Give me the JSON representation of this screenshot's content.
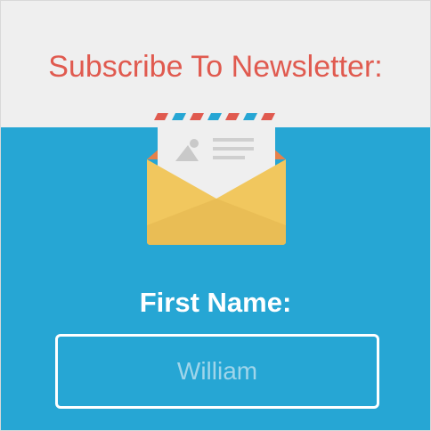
{
  "newsletter": {
    "title": "Subscribe To Newsletter:",
    "icon": "envelope-letter-icon",
    "first_name_label": "First Name:",
    "first_name_placeholder": "William"
  },
  "colors": {
    "header_bg": "#efefef",
    "title": "#e05a4f",
    "body_bg": "#26a6d4",
    "label": "#ffffff",
    "placeholder": "#9fd5ea",
    "envelope": "#f1c75e",
    "airmail_red": "#e05a4f",
    "airmail_blue": "#26a6d4"
  }
}
